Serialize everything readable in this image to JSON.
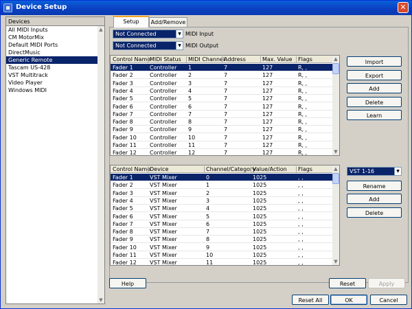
{
  "window": {
    "title": "Device Setup"
  },
  "devices": {
    "header": "Devices",
    "items": [
      "All MIDI Inputs",
      "CM MotorMix",
      "Default MIDI Ports",
      "DirectMusic",
      "Generic Remote",
      "Tascam US-428",
      "VST Multitrack",
      "Video Player",
      "Windows MIDI"
    ],
    "selected_index": 4
  },
  "tabs": [
    "Setup",
    "Add/Remove"
  ],
  "midi": {
    "input_value": "Not Connected",
    "input_label": "MIDI Input",
    "output_value": "Not Connected",
    "output_label": "MIDI Output"
  },
  "table1": {
    "headers": [
      "Control Name",
      "MIDI Status",
      "MIDI Channel",
      "Address",
      "Max. Value",
      "Flags"
    ],
    "rows": [
      [
        "Fader 1",
        "Controller",
        "1",
        "7",
        "127",
        "R, ,"
      ],
      [
        "Fader 2",
        "Controller",
        "2",
        "7",
        "127",
        "R, ,"
      ],
      [
        "Fader 3",
        "Controller",
        "3",
        "7",
        "127",
        "R, ,"
      ],
      [
        "Fader 4",
        "Controller",
        "4",
        "7",
        "127",
        "R, ,"
      ],
      [
        "Fader 5",
        "Controller",
        "5",
        "7",
        "127",
        "R, ,"
      ],
      [
        "Fader 6",
        "Controller",
        "6",
        "7",
        "127",
        "R, ,"
      ],
      [
        "Fader 7",
        "Controller",
        "7",
        "7",
        "127",
        "R, ,"
      ],
      [
        "Fader 8",
        "Controller",
        "8",
        "7",
        "127",
        "R, ,"
      ],
      [
        "Fader 9",
        "Controller",
        "9",
        "7",
        "127",
        "R, ,"
      ],
      [
        "Fader 10",
        "Controller",
        "10",
        "7",
        "127",
        "R, ,"
      ],
      [
        "Fader 11",
        "Controller",
        "11",
        "7",
        "127",
        "R, ,"
      ],
      [
        "Fader 12",
        "Controller",
        "12",
        "7",
        "127",
        "R, ,"
      ]
    ],
    "selected_index": 0
  },
  "table2": {
    "headers": [
      "Control Name",
      "Device",
      "Channel/Category",
      "Value/Action",
      "Flags"
    ],
    "rows": [
      [
        "Fader 1",
        "VST Mixer",
        "0",
        "1025",
        ", ,"
      ],
      [
        "Fader 2",
        "VST Mixer",
        "1",
        "1025",
        ", ,"
      ],
      [
        "Fader 3",
        "VST Mixer",
        "2",
        "1025",
        ", ,"
      ],
      [
        "Fader 4",
        "VST Mixer",
        "3",
        "1025",
        ", ,"
      ],
      [
        "Fader 5",
        "VST Mixer",
        "4",
        "1025",
        ", ,"
      ],
      [
        "Fader 6",
        "VST Mixer",
        "5",
        "1025",
        ", ,"
      ],
      [
        "Fader 7",
        "VST Mixer",
        "6",
        "1025",
        ", ,"
      ],
      [
        "Fader 8",
        "VST Mixer",
        "7",
        "1025",
        ", ,"
      ],
      [
        "Fader 9",
        "VST Mixer",
        "8",
        "1025",
        ", ,"
      ],
      [
        "Fader 10",
        "VST Mixer",
        "9",
        "1025",
        ", ,"
      ],
      [
        "Fader 11",
        "VST Mixer",
        "10",
        "1025",
        ", ,"
      ],
      [
        "Fader 12",
        "VST Mixer",
        "11",
        "1025",
        ", ,"
      ]
    ],
    "selected_index": 0
  },
  "buttons1": [
    "Import",
    "Export",
    "Add",
    "Delete",
    "Learn"
  ],
  "bank": {
    "value": "VST 1-16"
  },
  "buttons2": [
    "Rename",
    "Add",
    "Delete"
  ],
  "footer": {
    "help": "Help",
    "reset": "Reset",
    "apply": "Apply",
    "reset_all": "Reset All",
    "ok": "OK",
    "cancel": "Cancel"
  }
}
